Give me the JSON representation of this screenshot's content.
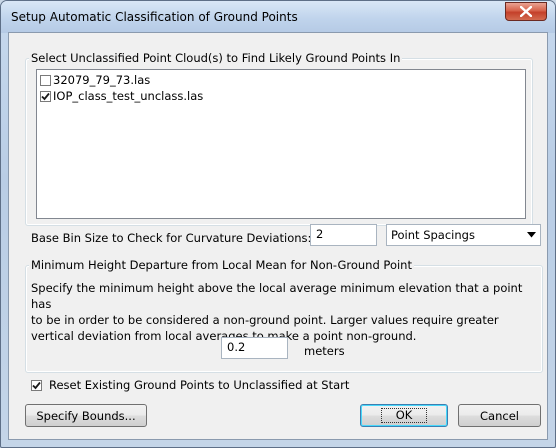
{
  "window": {
    "title": "Setup Automatic Classification of Ground Points"
  },
  "point_clouds": {
    "legend": "Select Unclassified Point Cloud(s) to Find Likely Ground Points In",
    "items": [
      {
        "label": "32079_79_73.las",
        "checked": false
      },
      {
        "label": "IOP_class_test_unclass.las",
        "checked": true
      }
    ]
  },
  "bin_size": {
    "label": "Base Bin Size to Check for Curvature Deviations:",
    "value": "2",
    "unit_selected": "Point Spacings"
  },
  "min_height": {
    "legend": "Minimum Height Departure from Local Mean for Non-Ground Point",
    "description_lines": [
      "Specify the minimum height above the local average minimum elevation that a point has",
      "to be in order to be considered a non-ground point. Larger values require greater",
      "vertical deviation from local averages to make a point non-ground."
    ],
    "value": "0.2",
    "unit": "meters"
  },
  "reset": {
    "label": "Reset Existing Ground Points to Unclassified at Start",
    "checked": true
  },
  "buttons": {
    "specify_bounds": "Specify Bounds...",
    "ok": "OK",
    "cancel": "Cancel"
  },
  "icons": {
    "close": "close-x-icon",
    "dropdown": "chevron-down-icon",
    "check": "checkmark-icon"
  }
}
